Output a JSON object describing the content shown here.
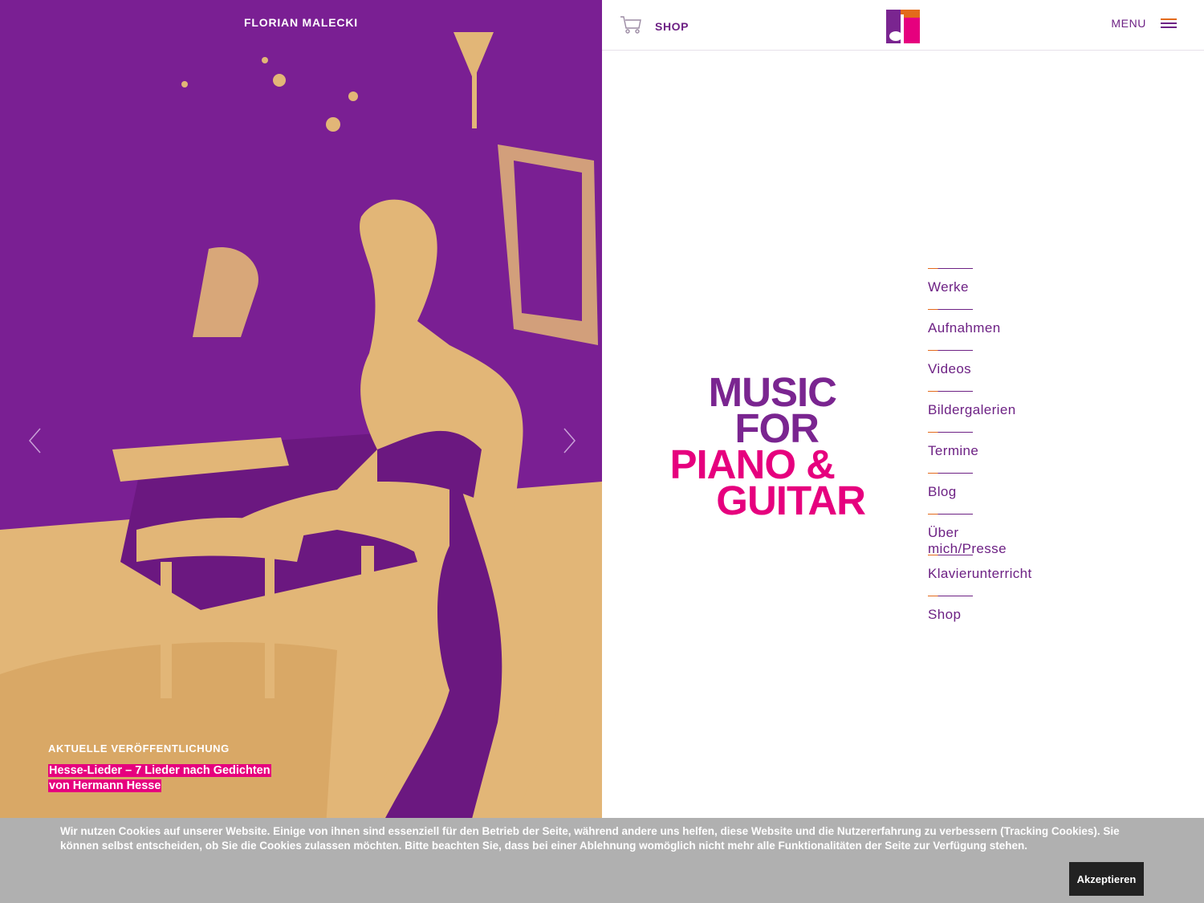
{
  "hero": {
    "brand": "FLORIAN MALECKI",
    "release_label": "AKTUELLE VERÖFFENTLICHUNG",
    "release_title": "Hesse-Lieder – 7 Lieder nach Gedichten von Hermann Hesse",
    "prev_icon": "chevron-left-icon",
    "next_icon": "chevron-right-icon"
  },
  "header": {
    "shop_label": "SHOP",
    "shop_icon": "cart-icon",
    "menu_label": "MENU",
    "menu_icon": "hamburger-icon"
  },
  "wordmark": {
    "line1": "MUSIC",
    "line2": "FOR",
    "line3": "PIANO &",
    "line4": "GUITAR"
  },
  "nav": {
    "items": [
      {
        "label": "Werke"
      },
      {
        "label": "Aufnahmen"
      },
      {
        "label": "Videos"
      },
      {
        "label": "Bildergalerien"
      },
      {
        "label": "Termine"
      },
      {
        "label": "Blog"
      },
      {
        "label": "Über mich/Presse"
      },
      {
        "label": "Klavierunterricht"
      },
      {
        "label": "Shop"
      }
    ]
  },
  "cookie": {
    "text": "Wir nutzen Cookies auf unserer Website. Einige von ihnen sind essenziell für den Betrieb der Seite, während andere uns helfen, diese Website und die Nutzererfahrung zu verbessern (Tracking Cookies). Sie können selbst entscheiden, ob Sie die Cookies zulassen möchten. Bitte beachten Sie, dass bei einer Ablehnung womöglich nicht mehr alle Funktionalitäten der Seite zur Verfügung stehen.",
    "accept_label": "Akzeptieren"
  },
  "colors": {
    "purple": "#7a1f93",
    "magenta": "#e6007e",
    "sand": "#e2b677",
    "orange": "#e36a1b"
  }
}
